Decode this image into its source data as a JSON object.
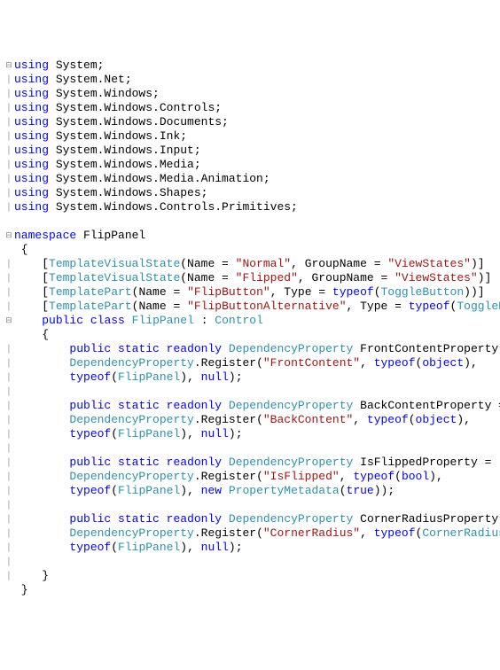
{
  "code": {
    "usings": [
      {
        "ns": "System"
      },
      {
        "ns": "System.Net"
      },
      {
        "ns": "System.Windows"
      },
      {
        "ns": "System.Windows.Controls"
      },
      {
        "ns": "System.Windows.Documents"
      },
      {
        "ns": "System.Windows.Ink"
      },
      {
        "ns": "System.Windows.Input"
      },
      {
        "ns": "System.Windows.Media"
      },
      {
        "ns": "System.Windows.Media.Animation"
      },
      {
        "ns": "System.Windows.Shapes"
      },
      {
        "ns": "System.Windows.Controls.Primitives"
      }
    ],
    "kw_using": "using",
    "kw_namespace": "namespace",
    "namespace_name": "FlipPanel",
    "brace_open": "{",
    "brace_close": "}",
    "attrs": [
      {
        "open": "[",
        "type": "TemplateVisualState",
        "paren_open": "(Name = ",
        "name": "\"Normal\"",
        "mid": ", GroupName = ",
        "group": "\"ViewStates\"",
        "close": ")]"
      },
      {
        "open": "[",
        "type": "TemplateVisualState",
        "paren_open": "(Name = ",
        "name": "\"Flipped\"",
        "mid": ", GroupName = ",
        "group": "\"ViewStates\"",
        "close": ")]"
      }
    ],
    "parts": [
      {
        "open": "[",
        "type": "TemplatePart",
        "paren_open": "(Name = ",
        "name": "\"FlipButton\"",
        "mid": ", Type = ",
        "kw_typeof": "typeof",
        "po": "(",
        "ptype": "ToggleButton",
        "pc": "))]"
      },
      {
        "open": "[",
        "type": "TemplatePart",
        "paren_open": "(Name = ",
        "name": "\"FlipButtonAlternative\"",
        "mid": ", Type = ",
        "kw_typeof": "typeof",
        "po": "(",
        "ptype": "ToggleButton",
        "pc": "))]"
      }
    ],
    "class_decl": {
      "kw_public": "public",
      "kw_class": "class",
      "name": "FlipPanel",
      "colon": " : ",
      "base": "Control"
    },
    "props": [
      {
        "mods": "public static readonly",
        "dp_type": "DependencyProperty",
        "field": "FrontContentProperty",
        "eq": " =",
        "reg_type": "DependencyProperty",
        "reg_call": ".Register(",
        "str_name": "\"FrontContent\"",
        "c1": ", ",
        "kw_typeof1": "typeof",
        "po1": "(",
        "t1": "object",
        "t1_is_kw": true,
        "pc1": "),",
        "kw_typeof2": "typeof",
        "po2": "(",
        "t2": "FlipPanel",
        "pc2": "), ",
        "meta_kw": "null",
        "meta_type": "",
        "meta_open": "",
        "meta_arg": "",
        "meta_close": ");"
      },
      {
        "mods": "public static readonly",
        "dp_type": "DependencyProperty",
        "field": "BackContentProperty",
        "eq": " =",
        "reg_type": "DependencyProperty",
        "reg_call": ".Register(",
        "str_name": "\"BackContent\"",
        "c1": ", ",
        "kw_typeof1": "typeof",
        "po1": "(",
        "t1": "object",
        "t1_is_kw": true,
        "pc1": "),",
        "kw_typeof2": "typeof",
        "po2": "(",
        "t2": "FlipPanel",
        "pc2": "), ",
        "meta_kw": "null",
        "meta_type": "",
        "meta_open": "",
        "meta_arg": "",
        "meta_close": ");"
      },
      {
        "mods": "public static readonly",
        "dp_type": "DependencyProperty",
        "field": "IsFlippedProperty",
        "eq": " =",
        "reg_type": "DependencyProperty",
        "reg_call": ".Register(",
        "str_name": "\"IsFlipped\"",
        "c1": ", ",
        "kw_typeof1": "typeof",
        "po1": "(",
        "t1": "bool",
        "t1_is_kw": true,
        "pc1": "),",
        "kw_typeof2": "typeof",
        "po2": "(",
        "t2": "FlipPanel",
        "pc2": "), ",
        "meta_kw": "new",
        "meta_type": "PropertyMetadata",
        "meta_open": "(",
        "meta_arg": "true",
        "meta_close": "));"
      },
      {
        "mods": "public static readonly",
        "dp_type": "DependencyProperty",
        "field": "CornerRadiusProperty",
        "eq": " =",
        "reg_type": "DependencyProperty",
        "reg_call": ".Register(",
        "str_name": "\"CornerRadius\"",
        "c1": ", ",
        "kw_typeof1": "typeof",
        "po1": "(",
        "t1": "CornerRadius",
        "t1_is_kw": false,
        "pc1": "),",
        "kw_typeof2": "typeof",
        "po2": "(",
        "t2": "FlipPanel",
        "pc2": "), ",
        "meta_kw": "null",
        "meta_type": "",
        "meta_open": "",
        "meta_arg": "",
        "meta_close": ");"
      }
    ],
    "minus": "⊟",
    "bar": "│"
  }
}
